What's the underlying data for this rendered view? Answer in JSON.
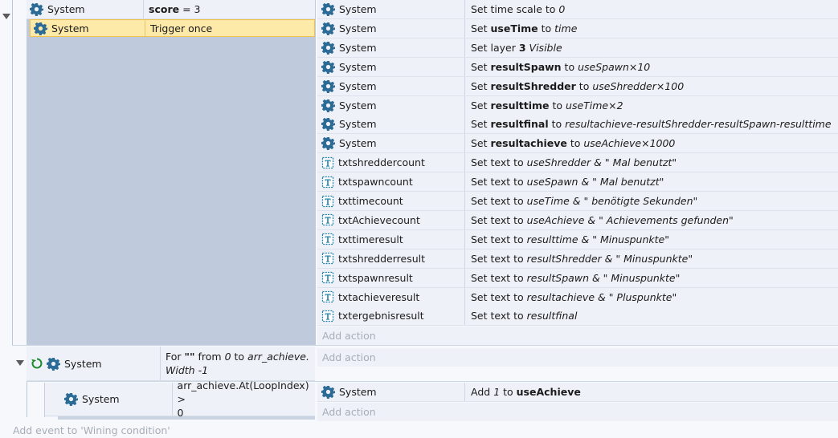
{
  "event1": {
    "conditions": [
      {
        "object": "System",
        "text_parts": [
          {
            "t": "score",
            "style": "b"
          },
          {
            "t": " = 3",
            "style": ""
          }
        ]
      },
      {
        "object": "System",
        "text_parts": [
          {
            "t": "Trigger once",
            "style": ""
          }
        ]
      }
    ],
    "actions": [
      {
        "object": "System",
        "icon": "gear",
        "parts": [
          {
            "t": "Set time scale to ",
            "s": ""
          },
          {
            "t": "0",
            "s": "i"
          }
        ]
      },
      {
        "object": "System",
        "icon": "gear",
        "parts": [
          {
            "t": "Set ",
            "s": ""
          },
          {
            "t": "useTime",
            "s": "b"
          },
          {
            "t": " to ",
            "s": ""
          },
          {
            "t": "time",
            "s": "i"
          }
        ]
      },
      {
        "object": "System",
        "icon": "gear",
        "parts": [
          {
            "t": "Set layer ",
            "s": ""
          },
          {
            "t": "3",
            "s": "b"
          },
          {
            "t": " ",
            "s": ""
          },
          {
            "t": "Visible",
            "s": "i"
          }
        ]
      },
      {
        "object": "System",
        "icon": "gear",
        "parts": [
          {
            "t": "Set ",
            "s": ""
          },
          {
            "t": "resultSpawn",
            "s": "b"
          },
          {
            "t": " to ",
            "s": ""
          },
          {
            "t": "useSpawn×10",
            "s": "i"
          }
        ]
      },
      {
        "object": "System",
        "icon": "gear",
        "parts": [
          {
            "t": "Set ",
            "s": ""
          },
          {
            "t": "resultShredder",
            "s": "b"
          },
          {
            "t": " to ",
            "s": ""
          },
          {
            "t": "useShredder×100",
            "s": "i"
          }
        ]
      },
      {
        "object": "System",
        "icon": "gear",
        "parts": [
          {
            "t": "Set ",
            "s": ""
          },
          {
            "t": "resulttime",
            "s": "b"
          },
          {
            "t": " to ",
            "s": ""
          },
          {
            "t": "useTime×2",
            "s": "i"
          }
        ]
      },
      {
        "object": "System",
        "icon": "gear",
        "parts": [
          {
            "t": "Set ",
            "s": ""
          },
          {
            "t": "resultfinal",
            "s": "b"
          },
          {
            "t": " to ",
            "s": ""
          },
          {
            "t": "resultachieve-resultShredder-resultSpawn-resulttime",
            "s": "i"
          }
        ]
      },
      {
        "object": "System",
        "icon": "gear",
        "parts": [
          {
            "t": "Set ",
            "s": ""
          },
          {
            "t": "resultachieve",
            "s": "b"
          },
          {
            "t": " to ",
            "s": ""
          },
          {
            "t": "useAchieve×1000",
            "s": "i"
          }
        ]
      },
      {
        "object": "txtshreddercount",
        "icon": "text",
        "parts": [
          {
            "t": "Set text to ",
            "s": ""
          },
          {
            "t": "useShredder & \" Mal benutzt\"",
            "s": "i"
          }
        ]
      },
      {
        "object": "txtspawncount",
        "icon": "text",
        "parts": [
          {
            "t": "Set text to ",
            "s": ""
          },
          {
            "t": "useSpawn & \" Mal benutzt\"",
            "s": "i"
          }
        ]
      },
      {
        "object": "txttimecount",
        "icon": "text",
        "parts": [
          {
            "t": "Set text to ",
            "s": ""
          },
          {
            "t": "useTime & \" benötigte Sekunden\"",
            "s": "i"
          }
        ]
      },
      {
        "object": "txtAchievecount",
        "icon": "text",
        "parts": [
          {
            "t": "Set text to ",
            "s": ""
          },
          {
            "t": "useAchieve & \" Achievements gefunden\"",
            "s": "i"
          }
        ]
      },
      {
        "object": "txttimeresult",
        "icon": "text",
        "parts": [
          {
            "t": "Set text to ",
            "s": ""
          },
          {
            "t": "resulttime & \" Minuspunkte\"",
            "s": "i"
          }
        ]
      },
      {
        "object": "txtshredderresult",
        "icon": "text",
        "parts": [
          {
            "t": "Set text to ",
            "s": ""
          },
          {
            "t": "resultShredder & \" Minuspunkte\"",
            "s": "i"
          }
        ]
      },
      {
        "object": "txtspawnresult",
        "icon": "text",
        "parts": [
          {
            "t": "Set text to ",
            "s": ""
          },
          {
            "t": "resultSpawn & \" Minuspunkte\"",
            "s": "i"
          }
        ]
      },
      {
        "object": "txtachieveresult",
        "icon": "text",
        "parts": [
          {
            "t": "Set text to ",
            "s": ""
          },
          {
            "t": "resultachieve & \" Pluspunkte\"",
            "s": "i"
          }
        ]
      },
      {
        "object": "txtergebnisresult",
        "icon": "text",
        "parts": [
          {
            "t": "Set text to ",
            "s": ""
          },
          {
            "t": "resultfinal",
            "s": "i"
          }
        ]
      }
    ],
    "add_action": "Add action"
  },
  "event2": {
    "object": "System",
    "text_parts": [
      {
        "t": "For ",
        "s": ""
      },
      {
        "t": "\"\"",
        "s": "b"
      },
      {
        "t": " from ",
        "s": ""
      },
      {
        "t": "0",
        "s": "i"
      },
      {
        "t": " to ",
        "s": ""
      },
      {
        "t": "arr_achieve.",
        "s": "i"
      },
      {
        "t": "\n",
        "s": "br"
      },
      {
        "t": "Width -1",
        "s": "i"
      }
    ],
    "add_action": "Add action"
  },
  "event3": {
    "object": "System",
    "text_parts": [
      {
        "t": "arr_achieve.At(LoopIndex) >",
        "s": ""
      },
      {
        "t": "\n",
        "s": "br"
      },
      {
        "t": "0",
        "s": ""
      }
    ],
    "action": {
      "object": "System",
      "parts": [
        {
          "t": "Add ",
          "s": ""
        },
        {
          "t": "1",
          "s": "i"
        },
        {
          "t": " to ",
          "s": ""
        },
        {
          "t": "useAchieve",
          "s": "b"
        }
      ]
    },
    "add_action": "Add action"
  },
  "footer": {
    "add_event": "Add event to 'Wining condition'"
  },
  "colors": {
    "selected_bg": "#fde9a8",
    "block_bg": "#bfcbdc",
    "row_bg": "#eef2f8",
    "gear": "#2c6b96",
    "text_icon": "#1f7fa8",
    "loop": "#1e8a2e"
  }
}
